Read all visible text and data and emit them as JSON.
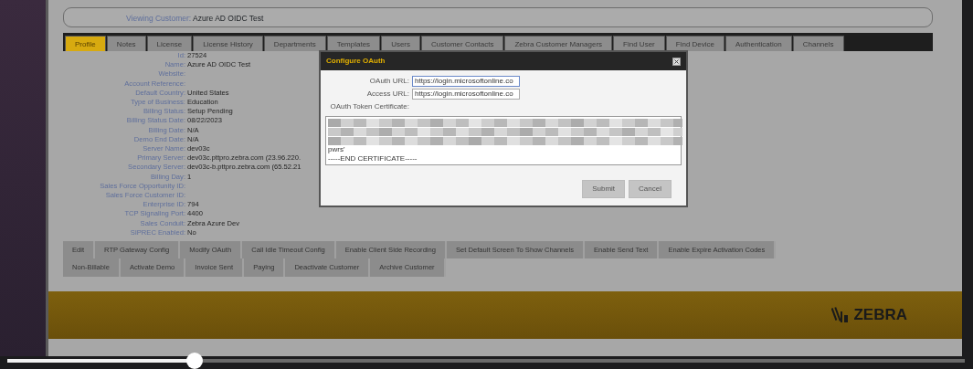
{
  "viewing_customer": {
    "label": "Viewing Customer:",
    "value": "Azure AD OIDC Test"
  },
  "tabs": [
    {
      "label": "Profile",
      "selected": true
    },
    {
      "label": "Notes",
      "selected": false
    },
    {
      "label": "License",
      "selected": false
    },
    {
      "label": "License History",
      "selected": false
    },
    {
      "label": "Departments",
      "selected": false
    },
    {
      "label": "Templates",
      "selected": false
    },
    {
      "label": "Users",
      "selected": false
    },
    {
      "label": "Customer Contacts",
      "selected": false
    },
    {
      "label": "Zebra Customer Managers",
      "selected": false
    },
    {
      "label": "Find User",
      "selected": false
    },
    {
      "label": "Find Device",
      "selected": false
    },
    {
      "label": "Authentication",
      "selected": false
    },
    {
      "label": "Channels",
      "selected": false
    }
  ],
  "profile": [
    {
      "label": "Id:",
      "value": "27524"
    },
    {
      "label": "Name:",
      "value": "Azure AD OIDC Test"
    },
    {
      "label": "Website:"
    },
    {
      "label": "Account Reference:"
    },
    {
      "label": "Default Country:",
      "value": "United States"
    },
    {
      "label": "Type of Business:",
      "value": "Education"
    },
    {
      "label": "Billing Status:",
      "value": "Setup Pending"
    },
    {
      "label": "Billing Status Date:",
      "value": "08/22/2023"
    },
    {
      "label": "Billing Date:",
      "value": "N/A"
    },
    {
      "label": "Demo End Date:",
      "value": "N/A"
    },
    {
      "label": "Server Name:",
      "value": "dev03c"
    },
    {
      "label": "Primary Server:",
      "value": "dev03c.pttpro.zebra.com (23.96.220."
    },
    {
      "label": "Secondary Server:",
      "value": "dev03c-b.pttpro.zebra.com (65.52.21"
    },
    {
      "label": "Billing Day:",
      "value": "1"
    },
    {
      "label": "Sales Force Opportunity ID:"
    },
    {
      "label": "Sales Force Customer ID:"
    },
    {
      "label": "Enterprise ID:",
      "value": "794"
    },
    {
      "label": "TCP Signaling Port:",
      "value": "4400"
    },
    {
      "label": "Sales Conduit:",
      "value": "Zebra Azure Dev"
    },
    {
      "label": "SIPREC Enabled:",
      "value": "No"
    }
  ],
  "actions": [
    [
      "Edit",
      "RTP Gateway Config",
      "Modify OAuth",
      "Call Idle Timeout Config",
      "Enable Client Side Recording",
      "Set Default Screen To Show Channels",
      "Enable Send Text",
      "Enable Expire Activation Codes"
    ],
    [
      "Non-Billable",
      "Activate Demo",
      "Invoice Sent",
      "Paying",
      "Deactivate Customer",
      "Archive Customer"
    ]
  ],
  "footer": {
    "logo": "ZEBRA"
  },
  "dialog": {
    "title": "Configure OAuth",
    "fields": [
      {
        "label": "OAuth URL:",
        "value": "https://login.microsoftonline.co",
        "focused": true
      },
      {
        "label": "Access URL:",
        "value": "https://login.microsoftonline.co",
        "focused": false
      }
    ],
    "certificate_label": "OAuth Token Certificate:",
    "certificate_lines": [
      "pwrs'",
      "-----END CERTIFICATE-----"
    ],
    "buttons": [
      "Submit",
      "Cancel"
    ]
  },
  "video": {
    "level": 0.196
  }
}
